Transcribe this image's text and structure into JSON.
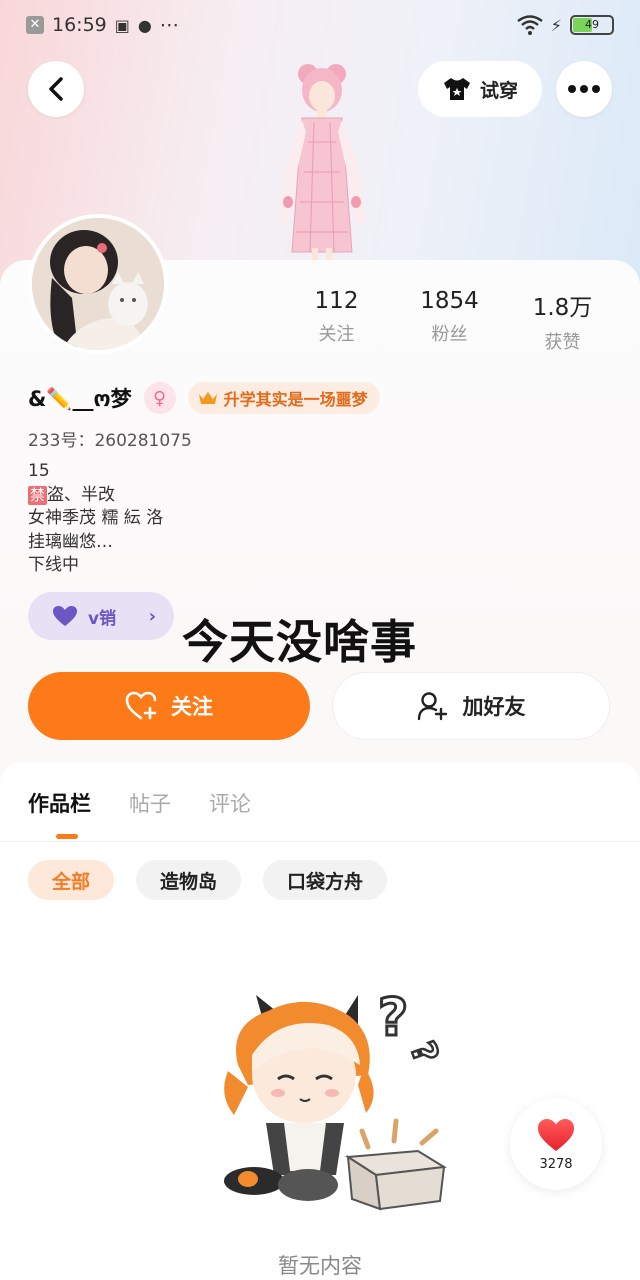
{
  "status_bar": {
    "time": "16:59",
    "extra_icons": "⋯",
    "battery": "49"
  },
  "header": {
    "tryon_label": "试穿"
  },
  "profile": {
    "stats": [
      {
        "value": "112",
        "label": "关注"
      },
      {
        "value": "1854",
        "label": "粉丝"
      },
      {
        "value": "1.8万",
        "label": "获赞"
      }
    ],
    "username": "&✏️__ო梦",
    "gender_icon": "♀",
    "title_badge": "升学其实是一场噩梦",
    "uid": "233号：260281075",
    "bio": {
      "line1": "15",
      "ban_tag": "禁",
      "line2_rest": "盗、半改",
      "line3": "女神季茂 糯 紜 洛",
      "line4": "挂璃幽悠…",
      "line5": "下线中"
    },
    "vtag": {
      "label": "v销"
    }
  },
  "overlay_caption": "今天没啥事",
  "actions": {
    "follow_label": "关注",
    "add_friend_label": "加好友"
  },
  "tabs": [
    {
      "label": "作品栏",
      "active": true
    },
    {
      "label": "帖子",
      "active": false
    },
    {
      "label": "评论",
      "active": false
    }
  ],
  "chips": [
    {
      "label": "全部",
      "active": true
    },
    {
      "label": "造物岛",
      "active": false
    },
    {
      "label": "口袋方舟",
      "active": false
    }
  ],
  "empty_state": {
    "text": "暂无内容"
  },
  "like_fab": {
    "count": "3278"
  },
  "colors": {
    "accent": "#fd7a18",
    "vtag": "#6c55c4"
  }
}
